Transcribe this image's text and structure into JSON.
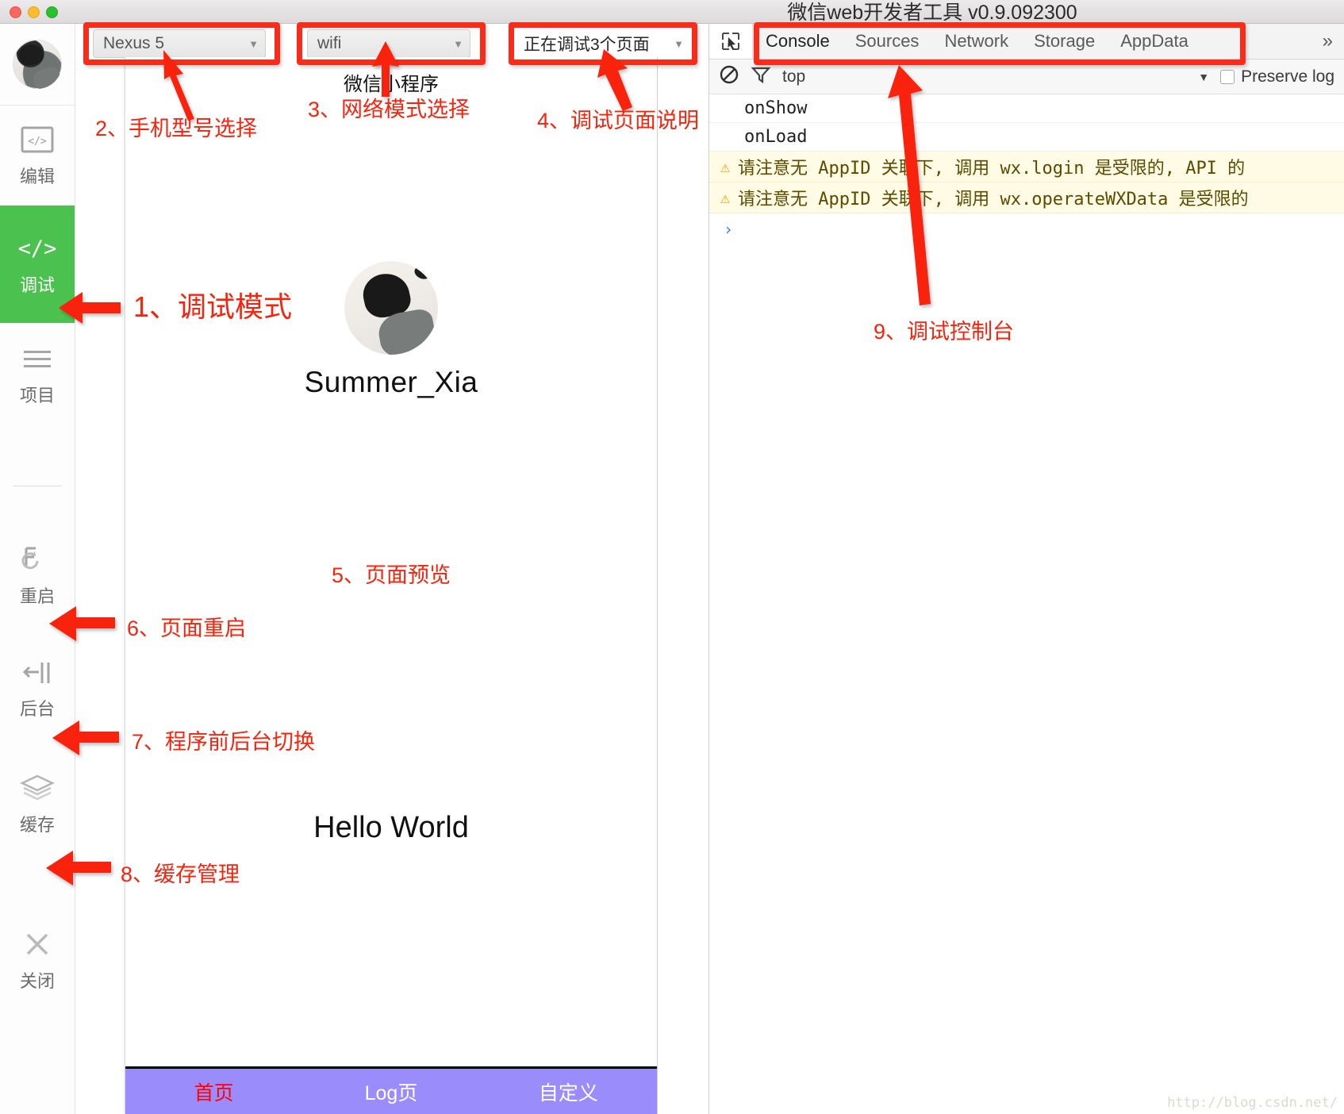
{
  "window": {
    "title": "微信web开发者工具 v0.9.092300",
    "traffic_colors": {
      "close": "#f9685f",
      "minimize": "#fbbd2e",
      "zoom": "#2ac02f"
    }
  },
  "sidebar": {
    "items": [
      {
        "icon": "code-window-icon",
        "label": "编辑",
        "active": false
      },
      {
        "icon": "code-brackets-icon",
        "label": "调试",
        "active": true
      },
      {
        "icon": "hamburger-lines-icon",
        "label": "项目",
        "active": false
      },
      {
        "icon": "restart-refresh-icon",
        "label": "重启",
        "active": false
      },
      {
        "icon": "background-switch-icon",
        "label": "后台",
        "active": false
      },
      {
        "icon": "layers-stack-icon",
        "label": "缓存",
        "active": false
      },
      {
        "icon": "close-x-icon",
        "label": "关闭",
        "active": false
      }
    ]
  },
  "toolbar": {
    "device_select": {
      "value": "Nexus 5",
      "caret": "▼"
    },
    "network_select": {
      "value": "wifi",
      "caret": "▼"
    },
    "pages_select": {
      "value": "正在调试3个页面",
      "caret": "▼"
    }
  },
  "phone": {
    "nav_title": "微信小程序",
    "profile_name": "Summer_Xia",
    "hello_text": "Hello World",
    "tabbar": [
      {
        "label": "首页",
        "active": true
      },
      {
        "label": "Log页",
        "active": false
      },
      {
        "label": "自定义",
        "active": false
      }
    ]
  },
  "devtools": {
    "inspect_icon": "inspect-cursor-icon",
    "tabs": [
      {
        "label": "Console",
        "active": true
      },
      {
        "label": "Sources",
        "active": false
      },
      {
        "label": "Network",
        "active": false
      },
      {
        "label": "Storage",
        "active": false
      },
      {
        "label": "AppData",
        "active": false
      }
    ],
    "more_tabs": "»",
    "filterbar": {
      "clear_icon": "clear-console-icon",
      "filter_icon": "funnel-filter-icon",
      "context": "top",
      "context_caret": "▼",
      "preserve_log_label": "Preserve log",
      "preserve_log_checked": false
    },
    "console_lines": [
      {
        "type": "log",
        "text": "onShow"
      },
      {
        "type": "log",
        "text": "onLoad"
      },
      {
        "type": "warn",
        "icon": "warning-triangle-icon",
        "text": "请注意无 AppID 关联下, 调用 wx.login 是受限的, API 的"
      },
      {
        "type": "warn",
        "icon": "warning-triangle-icon",
        "text": "请注意无 AppID 关联下, 调用 wx.operateWXData 是受限的"
      }
    ],
    "prompt": "›"
  },
  "annotations": [
    {
      "id": "n1",
      "text": "1、调试模式"
    },
    {
      "id": "n2",
      "text": "2、手机型号选择"
    },
    {
      "id": "n3",
      "text": "3、网络模式选择"
    },
    {
      "id": "n4",
      "text": "4、调试页面说明"
    },
    {
      "id": "n5",
      "text": "5、页面预览"
    },
    {
      "id": "n6",
      "text": "6、页面重启"
    },
    {
      "id": "n7",
      "text": "7、程序前后台切换"
    },
    {
      "id": "n8",
      "text": "8、缓存管理"
    },
    {
      "id": "n9",
      "text": "9、调试控制台"
    }
  ],
  "watermark": "http://blog.csdn.net/",
  "colors": {
    "annotation_red": "#f8230d",
    "highlight_red": "#fb2b19",
    "active_green": "#4bc24f",
    "tabbar_purple": "#9b8cfb",
    "warn_bg": "#fffbe5"
  }
}
